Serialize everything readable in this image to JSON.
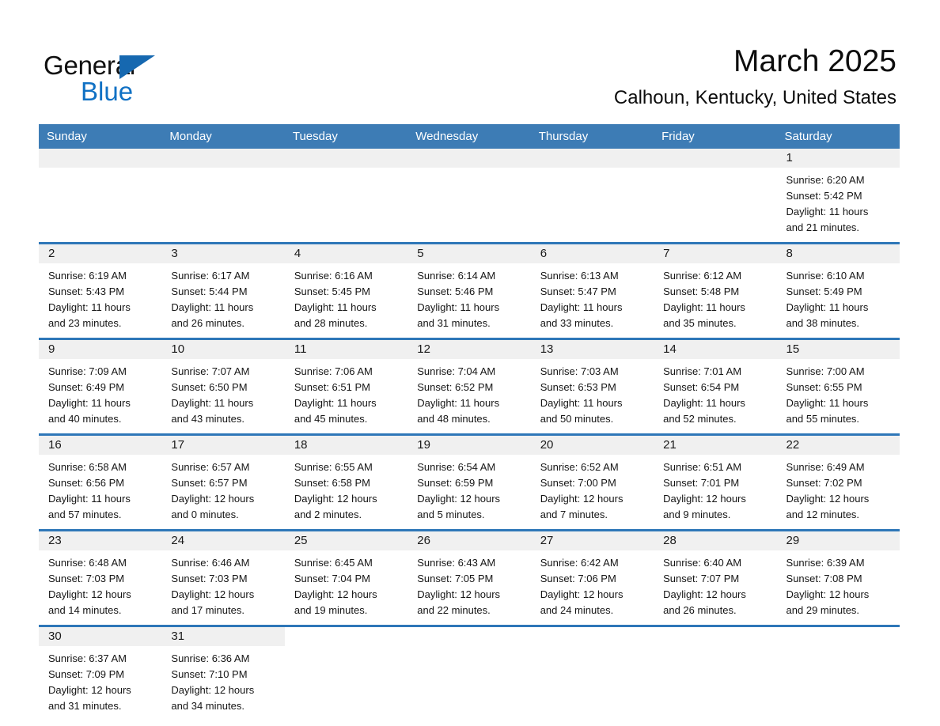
{
  "logo": {
    "word_black": "General",
    "word_blue": "Blue",
    "triangle_color": "#1668b0",
    "blue_color": "#1071c4"
  },
  "header": {
    "title": "March 2025",
    "subtitle": "Calhoun, Kentucky, United States"
  },
  "theme": {
    "header_bar_color": "#3d7cb5",
    "row_divider_color": "#2e77b8",
    "date_band_color": "#f0f0f0"
  },
  "weekdays": [
    "Sunday",
    "Monday",
    "Tuesday",
    "Wednesday",
    "Thursday",
    "Friday",
    "Saturday"
  ],
  "labels": {
    "sunrise_prefix": "Sunrise:",
    "sunset_prefix": "Sunset:",
    "daylight_prefix": "Daylight:"
  },
  "weeks": [
    {
      "days": [
        {
          "empty": true
        },
        {
          "empty": true
        },
        {
          "empty": true
        },
        {
          "empty": true
        },
        {
          "empty": true
        },
        {
          "empty": true
        },
        {
          "date": "1",
          "sunrise": "Sunrise: 6:20 AM",
          "sunset": "Sunset: 5:42 PM",
          "daylight1": "Daylight: 11 hours",
          "daylight2": "and 21 minutes."
        }
      ]
    },
    {
      "days": [
        {
          "date": "2",
          "sunrise": "Sunrise: 6:19 AM",
          "sunset": "Sunset: 5:43 PM",
          "daylight1": "Daylight: 11 hours",
          "daylight2": "and 23 minutes."
        },
        {
          "date": "3",
          "sunrise": "Sunrise: 6:17 AM",
          "sunset": "Sunset: 5:44 PM",
          "daylight1": "Daylight: 11 hours",
          "daylight2": "and 26 minutes."
        },
        {
          "date": "4",
          "sunrise": "Sunrise: 6:16 AM",
          "sunset": "Sunset: 5:45 PM",
          "daylight1": "Daylight: 11 hours",
          "daylight2": "and 28 minutes."
        },
        {
          "date": "5",
          "sunrise": "Sunrise: 6:14 AM",
          "sunset": "Sunset: 5:46 PM",
          "daylight1": "Daylight: 11 hours",
          "daylight2": "and 31 minutes."
        },
        {
          "date": "6",
          "sunrise": "Sunrise: 6:13 AM",
          "sunset": "Sunset: 5:47 PM",
          "daylight1": "Daylight: 11 hours",
          "daylight2": "and 33 minutes."
        },
        {
          "date": "7",
          "sunrise": "Sunrise: 6:12 AM",
          "sunset": "Sunset: 5:48 PM",
          "daylight1": "Daylight: 11 hours",
          "daylight2": "and 35 minutes."
        },
        {
          "date": "8",
          "sunrise": "Sunrise: 6:10 AM",
          "sunset": "Sunset: 5:49 PM",
          "daylight1": "Daylight: 11 hours",
          "daylight2": "and 38 minutes."
        }
      ]
    },
    {
      "days": [
        {
          "date": "9",
          "sunrise": "Sunrise: 7:09 AM",
          "sunset": "Sunset: 6:49 PM",
          "daylight1": "Daylight: 11 hours",
          "daylight2": "and 40 minutes."
        },
        {
          "date": "10",
          "sunrise": "Sunrise: 7:07 AM",
          "sunset": "Sunset: 6:50 PM",
          "daylight1": "Daylight: 11 hours",
          "daylight2": "and 43 minutes."
        },
        {
          "date": "11",
          "sunrise": "Sunrise: 7:06 AM",
          "sunset": "Sunset: 6:51 PM",
          "daylight1": "Daylight: 11 hours",
          "daylight2": "and 45 minutes."
        },
        {
          "date": "12",
          "sunrise": "Sunrise: 7:04 AM",
          "sunset": "Sunset: 6:52 PM",
          "daylight1": "Daylight: 11 hours",
          "daylight2": "and 48 minutes."
        },
        {
          "date": "13",
          "sunrise": "Sunrise: 7:03 AM",
          "sunset": "Sunset: 6:53 PM",
          "daylight1": "Daylight: 11 hours",
          "daylight2": "and 50 minutes."
        },
        {
          "date": "14",
          "sunrise": "Sunrise: 7:01 AM",
          "sunset": "Sunset: 6:54 PM",
          "daylight1": "Daylight: 11 hours",
          "daylight2": "and 52 minutes."
        },
        {
          "date": "15",
          "sunrise": "Sunrise: 7:00 AM",
          "sunset": "Sunset: 6:55 PM",
          "daylight1": "Daylight: 11 hours",
          "daylight2": "and 55 minutes."
        }
      ]
    },
    {
      "days": [
        {
          "date": "16",
          "sunrise": "Sunrise: 6:58 AM",
          "sunset": "Sunset: 6:56 PM",
          "daylight1": "Daylight: 11 hours",
          "daylight2": "and 57 minutes."
        },
        {
          "date": "17",
          "sunrise": "Sunrise: 6:57 AM",
          "sunset": "Sunset: 6:57 PM",
          "daylight1": "Daylight: 12 hours",
          "daylight2": "and 0 minutes."
        },
        {
          "date": "18",
          "sunrise": "Sunrise: 6:55 AM",
          "sunset": "Sunset: 6:58 PM",
          "daylight1": "Daylight: 12 hours",
          "daylight2": "and 2 minutes."
        },
        {
          "date": "19",
          "sunrise": "Sunrise: 6:54 AM",
          "sunset": "Sunset: 6:59 PM",
          "daylight1": "Daylight: 12 hours",
          "daylight2": "and 5 minutes."
        },
        {
          "date": "20",
          "sunrise": "Sunrise: 6:52 AM",
          "sunset": "Sunset: 7:00 PM",
          "daylight1": "Daylight: 12 hours",
          "daylight2": "and 7 minutes."
        },
        {
          "date": "21",
          "sunrise": "Sunrise: 6:51 AM",
          "sunset": "Sunset: 7:01 PM",
          "daylight1": "Daylight: 12 hours",
          "daylight2": "and 9 minutes."
        },
        {
          "date": "22",
          "sunrise": "Sunrise: 6:49 AM",
          "sunset": "Sunset: 7:02 PM",
          "daylight1": "Daylight: 12 hours",
          "daylight2": "and 12 minutes."
        }
      ]
    },
    {
      "days": [
        {
          "date": "23",
          "sunrise": "Sunrise: 6:48 AM",
          "sunset": "Sunset: 7:03 PM",
          "daylight1": "Daylight: 12 hours",
          "daylight2": "and 14 minutes."
        },
        {
          "date": "24",
          "sunrise": "Sunrise: 6:46 AM",
          "sunset": "Sunset: 7:03 PM",
          "daylight1": "Daylight: 12 hours",
          "daylight2": "and 17 minutes."
        },
        {
          "date": "25",
          "sunrise": "Sunrise: 6:45 AM",
          "sunset": "Sunset: 7:04 PM",
          "daylight1": "Daylight: 12 hours",
          "daylight2": "and 19 minutes."
        },
        {
          "date": "26",
          "sunrise": "Sunrise: 6:43 AM",
          "sunset": "Sunset: 7:05 PM",
          "daylight1": "Daylight: 12 hours",
          "daylight2": "and 22 minutes."
        },
        {
          "date": "27",
          "sunrise": "Sunrise: 6:42 AM",
          "sunset": "Sunset: 7:06 PM",
          "daylight1": "Daylight: 12 hours",
          "daylight2": "and 24 minutes."
        },
        {
          "date": "28",
          "sunrise": "Sunrise: 6:40 AM",
          "sunset": "Sunset: 7:07 PM",
          "daylight1": "Daylight: 12 hours",
          "daylight2": "and 26 minutes."
        },
        {
          "date": "29",
          "sunrise": "Sunrise: 6:39 AM",
          "sunset": "Sunset: 7:08 PM",
          "daylight1": "Daylight: 12 hours",
          "daylight2": "and 29 minutes."
        }
      ]
    },
    {
      "days": [
        {
          "date": "30",
          "sunrise": "Sunrise: 6:37 AM",
          "sunset": "Sunset: 7:09 PM",
          "daylight1": "Daylight: 12 hours",
          "daylight2": "and 31 minutes."
        },
        {
          "date": "31",
          "sunrise": "Sunrise: 6:36 AM",
          "sunset": "Sunset: 7:10 PM",
          "daylight1": "Daylight: 12 hours",
          "daylight2": "and 34 minutes."
        },
        {
          "blank": true
        },
        {
          "blank": true
        },
        {
          "blank": true
        },
        {
          "blank": true
        },
        {
          "blank": true
        }
      ]
    }
  ]
}
